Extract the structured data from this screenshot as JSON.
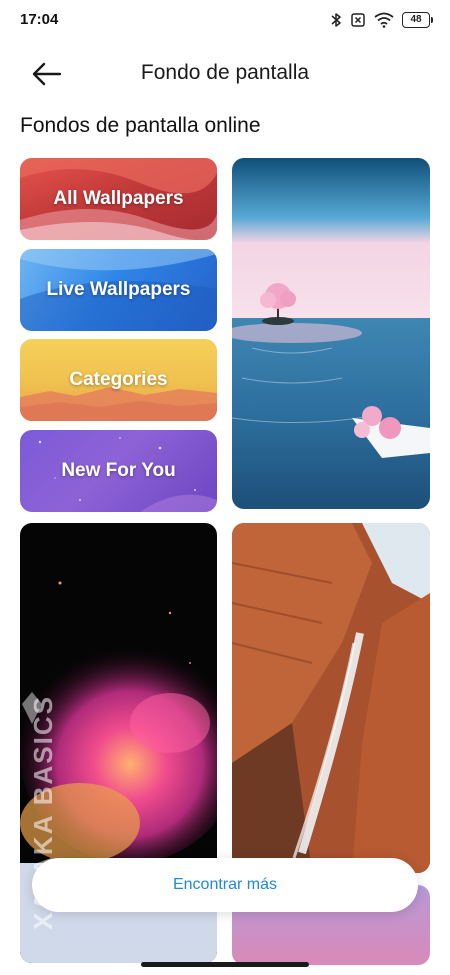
{
  "status_bar": {
    "time": "17:04",
    "battery": "48",
    "icons": [
      "bluetooth-icon",
      "sim-none-icon",
      "wifi-icon",
      "battery-icon"
    ]
  },
  "header": {
    "title": "Fondo de pantalla",
    "back_icon": "arrow-left-icon"
  },
  "section": {
    "title": "Fondos de pantalla online"
  },
  "tiles": [
    {
      "label": "All Wallpapers",
      "color": "#c23a3a"
    },
    {
      "label": "Live Wallpapers",
      "color": "#2f86e8"
    },
    {
      "label": "Categories",
      "color": "#f0c04e"
    },
    {
      "label": "New For You",
      "color": "#8e62d6"
    }
  ],
  "wallpapers": [
    {
      "name": "lake-tree-wallpaper"
    },
    {
      "name": "color-dust-wallpaper"
    },
    {
      "name": "canyon-waterfall-wallpaper"
    },
    {
      "name": "purple-sky-wallpaper"
    }
  ],
  "find_more": {
    "label": "Encontrar más",
    "color": "#1f8ad6"
  },
  "watermark": {
    "text": "XATAKA BASICS"
  }
}
